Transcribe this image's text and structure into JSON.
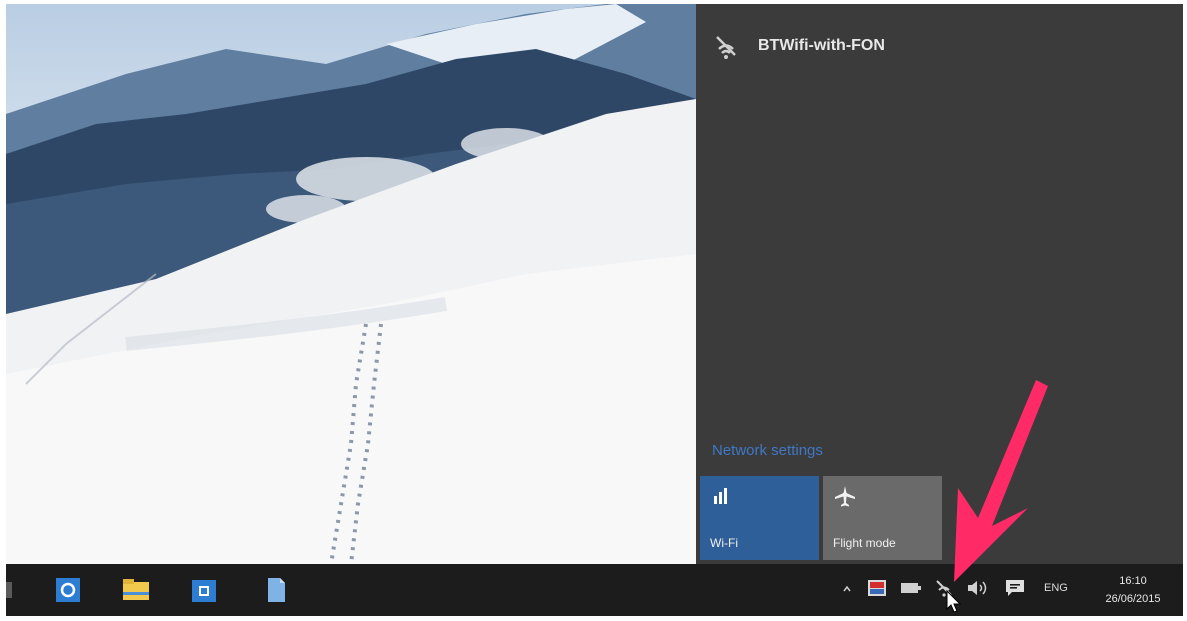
{
  "network": {
    "ssid": "BTWifi-with-FON",
    "settings_link": "Network settings"
  },
  "quick_actions": {
    "wifi_label": "Wi-Fi",
    "flight_label": "Flight mode"
  },
  "taskbar": {
    "apps": [
      "Internet Explorer",
      "File Explorer",
      "Store",
      "Document"
    ],
    "language": "ENG",
    "time": "16:10",
    "date": "26/06/2015"
  },
  "colors": {
    "flyout_bg": "#3b3b3b",
    "wifi_tile": "#2f5f98",
    "flight_tile": "#6a6a6a",
    "taskbar": "#1c1c1c",
    "annotation_arrow": "#ff2a66"
  }
}
